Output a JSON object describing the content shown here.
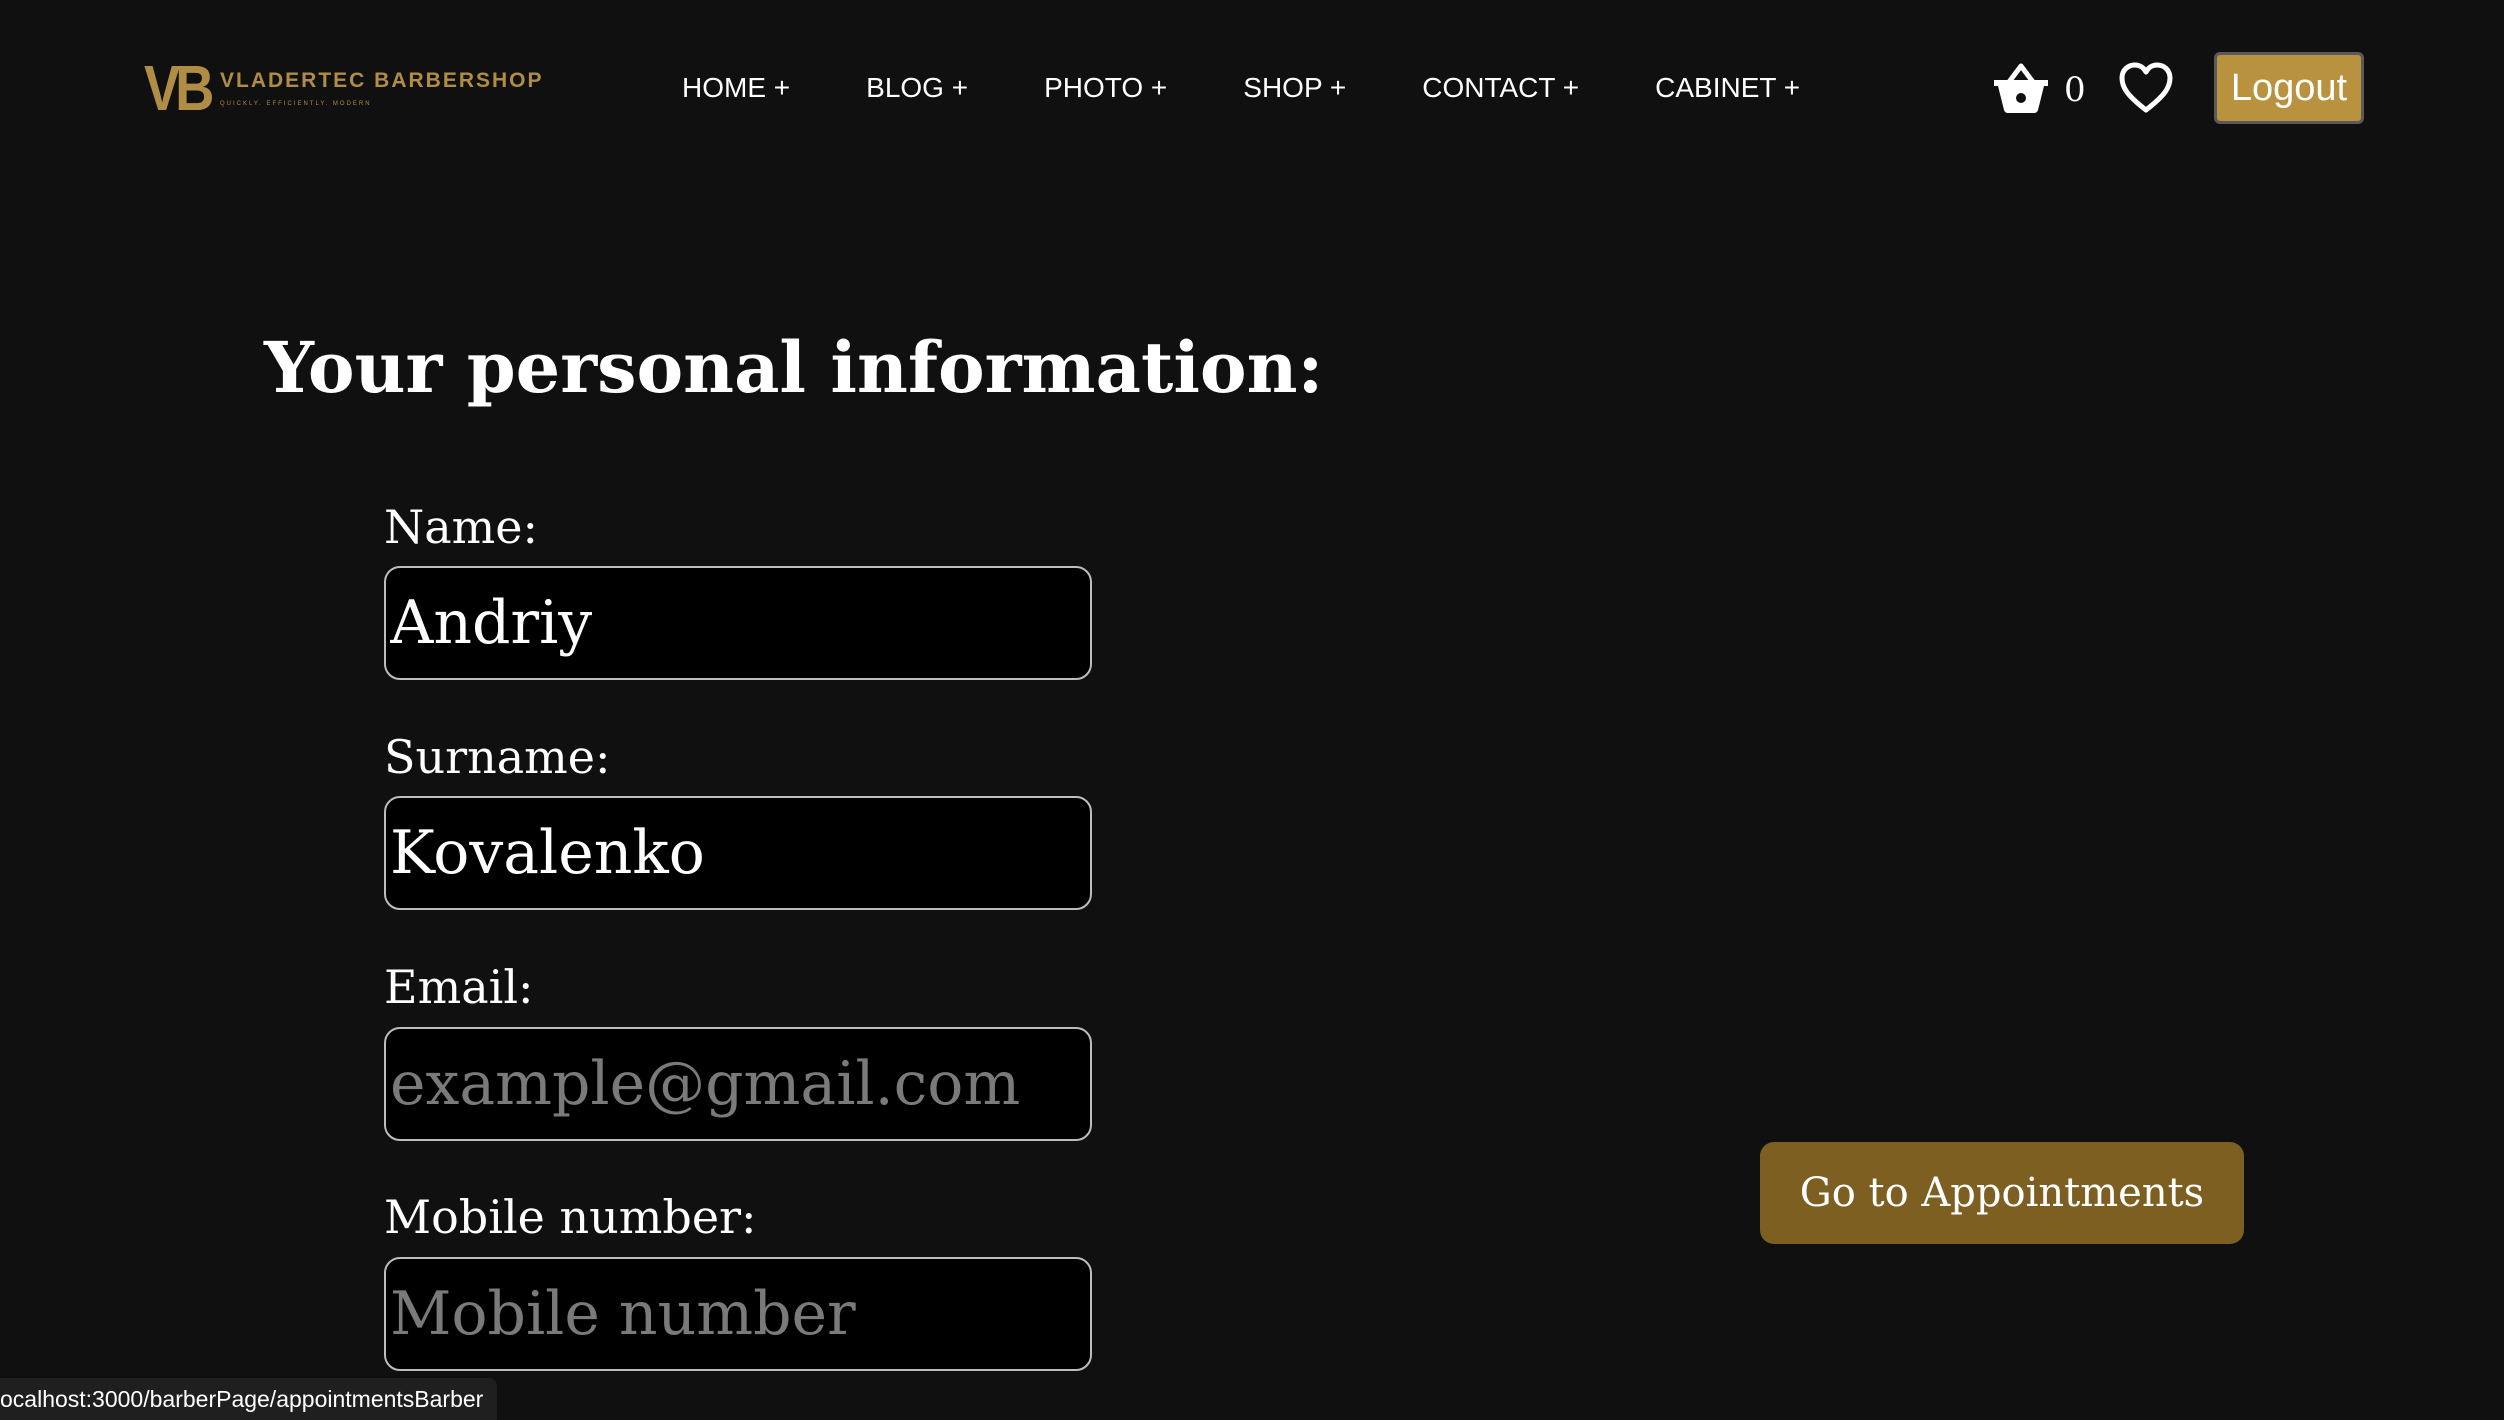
{
  "header": {
    "logo_mark": "VB",
    "logo_name": "VLADERTEC BARBERSHOP",
    "logo_tagline": "QUICKLY. EFFICIENTLY. MODERN",
    "nav": [
      {
        "label": "HOME +"
      },
      {
        "label": "BLOG +"
      },
      {
        "label": "PHOTO +"
      },
      {
        "label": "SHOP +"
      },
      {
        "label": "CONTACT +"
      },
      {
        "label": "CABINET +"
      }
    ],
    "cart_icon": "basket-icon",
    "cart_count": "0",
    "favorites_icon": "heart-icon",
    "logout_label": "Logout"
  },
  "main": {
    "title": "Your personal information:",
    "fields": {
      "name": {
        "label": "Name:",
        "value": "Andriy",
        "placeholder": ""
      },
      "surname": {
        "label": "Surname:",
        "value": "Kovalenko",
        "placeholder": ""
      },
      "email": {
        "label": "Email:",
        "value": "",
        "placeholder": "example@gmail.com"
      },
      "mobile": {
        "label": "Mobile number:",
        "value": "",
        "placeholder": "Mobile number"
      }
    },
    "appointments_label": "Go to Appointments"
  },
  "status_bar": {
    "url": "ocalhost:3000/barberPage/appointmentsBarber"
  },
  "colors": {
    "background": "#101010",
    "accent_gold": "#b8923f",
    "button_gold": "#7d5f22",
    "logo_gold": "#b08d44"
  }
}
